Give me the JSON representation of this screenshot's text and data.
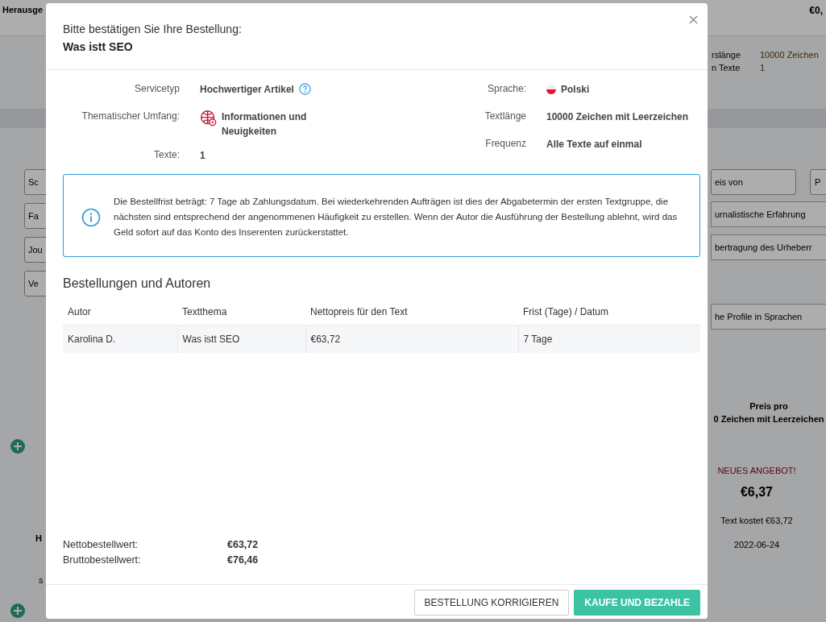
{
  "background": {
    "header_left": "Herausge",
    "header_right": "€0,",
    "summary": [
      {
        "label": "rslänge",
        "value": "10000 Zeichen"
      },
      {
        "label": "n Texte",
        "value": "1"
      }
    ],
    "fields_left": [
      "Sc",
      "Fa",
      "Jou",
      "Ve"
    ],
    "fields_right": [
      {
        "text": "eis von",
        "kind": "field"
      },
      {
        "text": "P",
        "kind": "field"
      },
      {
        "text": "urnalistische Erfahrung",
        "kind": "option"
      },
      {
        "text": "bertragung des Urheberr",
        "kind": "option"
      },
      {
        "text": "he Profile in Sprachen",
        "kind": "option"
      }
    ],
    "price_header": [
      "Preis pro",
      "0 Zeichen mit Leerzeichen"
    ],
    "offer": {
      "badge": "NEUES ANGEBOT!",
      "price": "€6,37",
      "cost": "Text kostet €63,72",
      "date": "2022-06-24"
    },
    "left_fragments": [
      "H",
      "s"
    ]
  },
  "modal": {
    "title": "Bitte bestätigen Sie Ihre Bestellung:",
    "subtitle": "Was istt SEO",
    "details_left": [
      {
        "label": "Servicetyp",
        "value": "Hochwertiger Artikel",
        "kind": "help"
      },
      {
        "label": "Thematischer Umfang:",
        "value": "Informationen und Neuigkeiten",
        "kind": "topic"
      },
      {
        "label": "Texte:",
        "value": "1",
        "kind": "plain"
      }
    ],
    "details_right": [
      {
        "label": "Sprache:",
        "value": "Polski",
        "kind": "flag"
      },
      {
        "label": "Textlänge",
        "value": "10000 Zeichen mit Leerzeichen",
        "kind": "plain"
      },
      {
        "label": "Frequenz",
        "value": "Alle Texte auf einmal",
        "kind": "plain"
      }
    ],
    "notice": "Die Bestellfrist beträgt: 7 Tage ab Zahlungsdatum. Bei wiederkehrenden Aufträgen ist dies der Abgabetermin der ersten Textgruppe, die nächsten sind entsprechend der angenommenen Häufigkeit zu erstellen. Wenn der Autor die Ausführung der Bestellung ablehnt, wird das Geld sofort auf das Konto des Inserenten zurückerstattet.",
    "orders": {
      "heading": "Bestellungen und Autoren",
      "columns": [
        "Autor",
        "Textthema",
        "Nettopreis für den Text",
        "Frist (Tage) / Datum"
      ],
      "rows": [
        [
          "Karolina D.",
          "Was istt SEO",
          "€63,72",
          "7 Tage"
        ]
      ]
    },
    "totals": [
      {
        "label": "Nettobestellwert:",
        "value": "€63,72"
      },
      {
        "label": "Bruttobestellwert:",
        "value": "€76,46"
      }
    ],
    "buttons": [
      {
        "label": "BESTELLUNG KORRIGIEREN",
        "kind": "secondary"
      },
      {
        "label": "KAUFE UND BEZAHLE",
        "kind": "primary"
      }
    ]
  }
}
